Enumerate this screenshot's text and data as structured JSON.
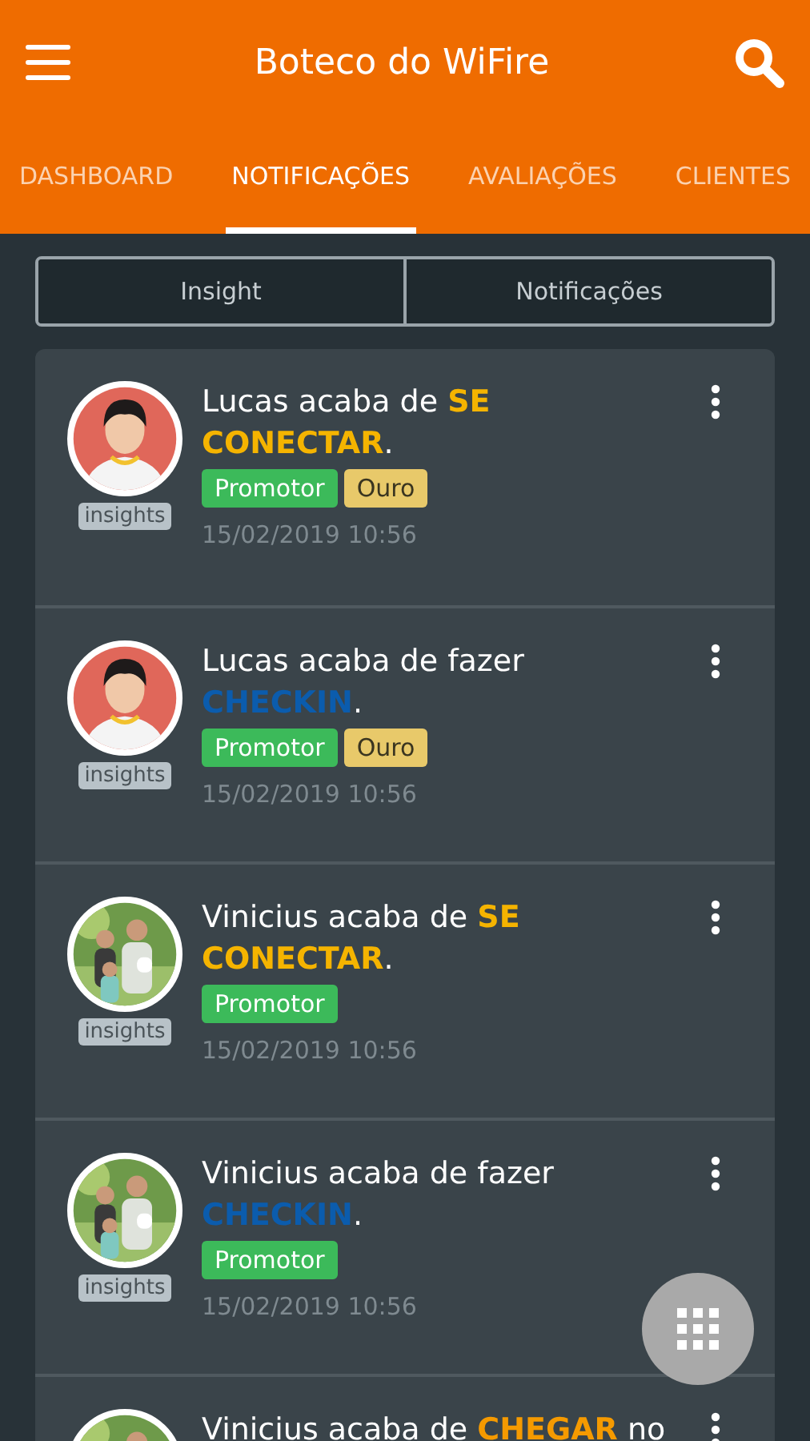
{
  "app_bar": {
    "title": "Boteco do WiFire"
  },
  "tabs": [
    {
      "label": "DASHBOARD",
      "selected": false
    },
    {
      "label": "NOTIFICAÇÕES",
      "selected": true
    },
    {
      "label": "AVALIAÇÕES",
      "selected": false
    },
    {
      "label": "CLIENTES",
      "selected": false
    }
  ],
  "segments": [
    {
      "label": "Insight",
      "selected": false
    },
    {
      "label": "Notificações",
      "selected": false
    }
  ],
  "notifications": [
    {
      "kind": "picture",
      "badge": "insights",
      "message": [
        {
          "text": "Lucas acaba de "
        },
        {
          "text": "SE CONECTAR",
          "color": "#f5b400"
        },
        {
          "text": "."
        }
      ],
      "tags": [
        {
          "label": "Promotor",
          "color": "#3cba5a"
        },
        {
          "label": "Ouro",
          "color": "#e8c96a"
        }
      ],
      "time": "15/02/2019 10:56"
    },
    {
      "kind": "picture",
      "badge": "insights",
      "message": [
        {
          "text": "Lucas acaba de fazer "
        },
        {
          "text": "CHECKIN",
          "color": "#0b5cad"
        },
        {
          "text": "."
        }
      ],
      "tags": [
        {
          "label": "Promotor",
          "color": "#3cba5a"
        },
        {
          "label": "Ouro",
          "color": "#e8c96a"
        }
      ],
      "time": "15/02/2019 10:56"
    },
    {
      "kind": "picture",
      "badge": "insights",
      "message": [
        {
          "text": "Vinicius acaba de "
        },
        {
          "text": "SE CONECTAR",
          "color": "#f5b400"
        },
        {
          "text": "."
        }
      ],
      "tags": [
        {
          "label": "Promotor",
          "color": "#3cba5a"
        }
      ],
      "time": "15/02/2019 10:56"
    },
    {
      "kind": "picture",
      "badge": "insights",
      "message": [
        {
          "text": "Vinicius acaba de fazer "
        },
        {
          "text": "CHECKIN",
          "color": "#0b5cad"
        },
        {
          "text": "."
        }
      ],
      "tags": [
        {
          "label": "Promotor",
          "color": "#3cba5a"
        }
      ],
      "time": "15/02/2019 10:56"
    },
    {
      "kind": "picture",
      "message": [
        {
          "text": "Vinicius acaba de "
        },
        {
          "text": "CHEGAR",
          "color": "#f59a00"
        },
        {
          "text": " no"
        }
      ]
    }
  ]
}
